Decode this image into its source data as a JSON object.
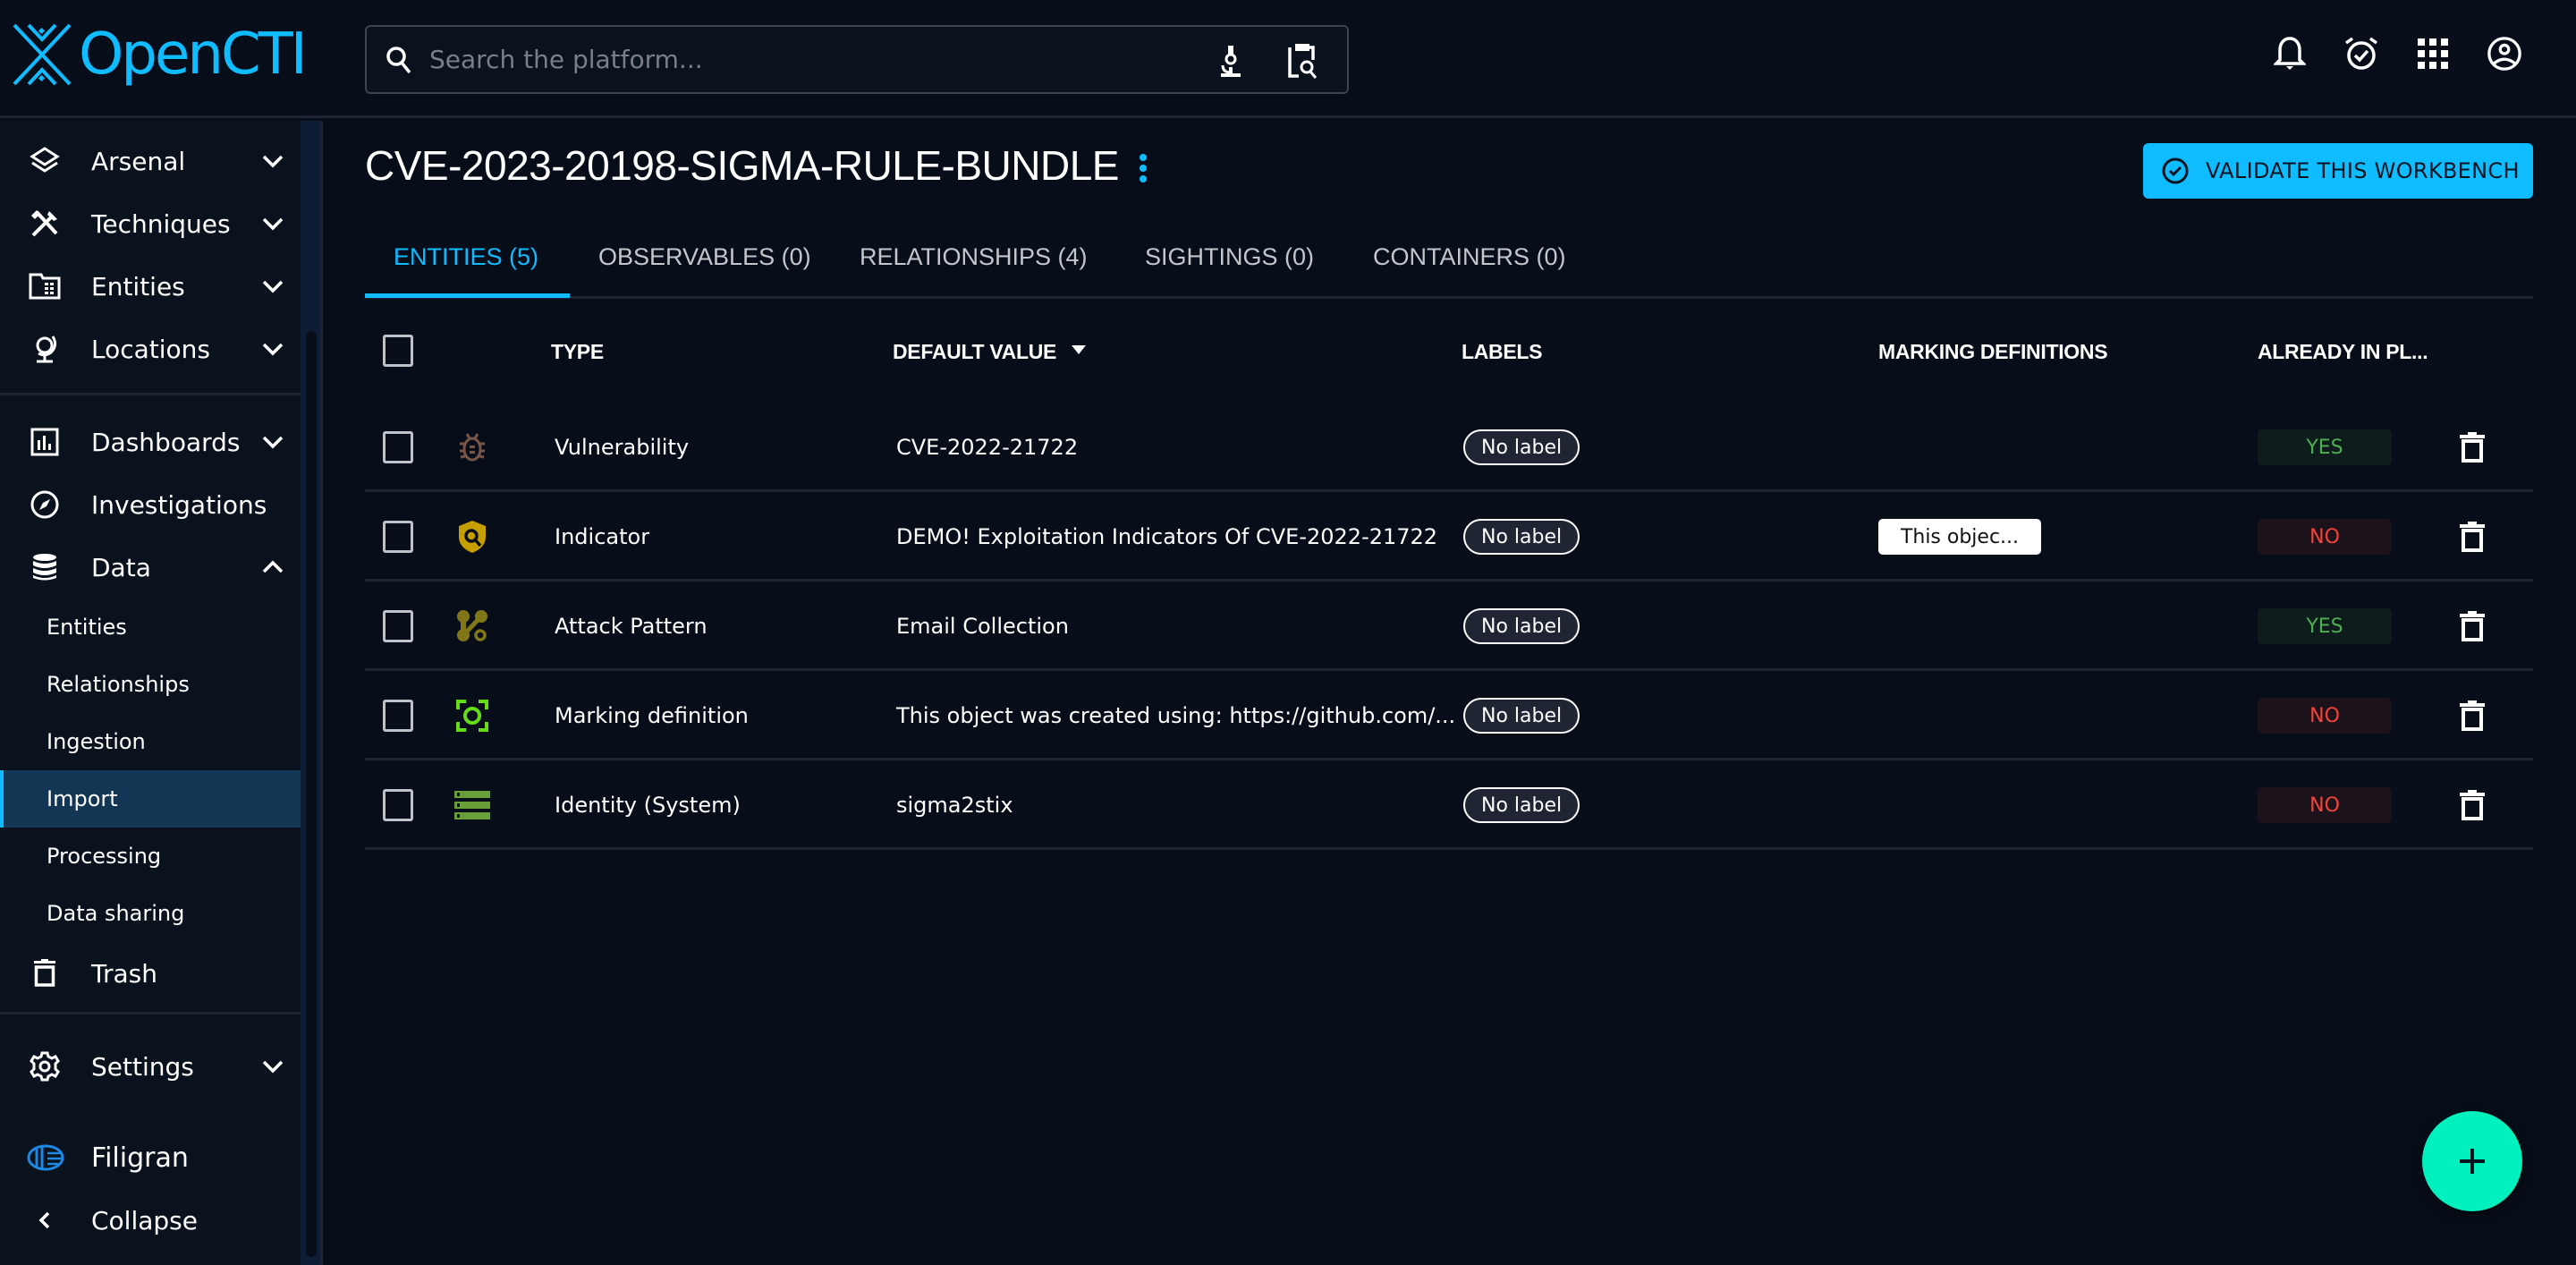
{
  "app": {
    "brand": "OpenCTI",
    "brand_color": "#0fbcff"
  },
  "search": {
    "placeholder": "Search the platform...",
    "value": "",
    "icons": [
      "search-icon",
      "microscope-icon",
      "clipboard-search-icon"
    ]
  },
  "top_icons": [
    "bell-icon",
    "alarm-check-icon",
    "apps-grid-icon",
    "account-circle-icon"
  ],
  "sidebar": {
    "items": [
      {
        "label": "Arsenal",
        "icon": "layers-icon",
        "expandable": true,
        "expanded": false
      },
      {
        "label": "Techniques",
        "icon": "tools-icon",
        "expandable": true,
        "expanded": false
      },
      {
        "label": "Entities",
        "icon": "folder-table-icon",
        "expandable": true,
        "expanded": false
      },
      {
        "label": "Locations",
        "icon": "globe-icon",
        "expandable": true,
        "expanded": false
      },
      {
        "label": "Dashboards",
        "icon": "chart-box-icon",
        "expandable": true,
        "expanded": false
      },
      {
        "label": "Investigations",
        "icon": "compass-icon",
        "expandable": false
      },
      {
        "label": "Data",
        "icon": "database-icon",
        "expandable": true,
        "expanded": true
      },
      {
        "label": "Trash",
        "icon": "trash-icon",
        "expandable": false
      },
      {
        "label": "Settings",
        "icon": "gear-icon",
        "expandable": true,
        "expanded": false
      }
    ],
    "data_subitems": [
      {
        "label": "Entities",
        "active": false
      },
      {
        "label": "Relationships",
        "active": false
      },
      {
        "label": "Ingestion",
        "active": false
      },
      {
        "label": "Import",
        "active": true
      },
      {
        "label": "Processing",
        "active": false
      },
      {
        "label": "Data sharing",
        "active": false
      }
    ],
    "footer_brand": "Filigran",
    "collapse_label": "Collapse"
  },
  "page": {
    "title": "CVE-2023-20198-SIGMA-RULE-BUNDLE",
    "validate_label": "VALIDATE THIS WORKBENCH"
  },
  "tabs": [
    {
      "label": "ENTITIES (5)",
      "active": true
    },
    {
      "label": "OBSERVABLES (0)",
      "active": false
    },
    {
      "label": "RELATIONSHIPS (4)",
      "active": false
    },
    {
      "label": "SIGHTINGS (0)",
      "active": false
    },
    {
      "label": "CONTAINERS (0)",
      "active": false
    }
  ],
  "table": {
    "headers": {
      "type": "TYPE",
      "default_value": "DEFAULT VALUE",
      "labels": "LABELS",
      "marking_definitions": "MARKING DEFINITIONS",
      "already_in_platform": "ALREADY IN PL..."
    },
    "sort": {
      "column": "default_value",
      "direction": "desc"
    },
    "rows": [
      {
        "type": "Vulnerability",
        "icon": "bug-icon",
        "icon_color": "#795548",
        "default_value": "CVE-2022-21722",
        "label": "No label",
        "marking": "",
        "already": "YES"
      },
      {
        "type": "Indicator",
        "icon": "shield-search-icon",
        "icon_color": "#c79e00",
        "default_value": "DEMO! Exploitation Indicators Of CVE-2022-21722",
        "label": "No label",
        "marking": "This objec...",
        "already": "NO"
      },
      {
        "type": "Attack Pattern",
        "icon": "attack-pattern-icon",
        "icon_color": "#827717",
        "default_value": "Email Collection",
        "label": "No label",
        "marking": "",
        "already": "YES"
      },
      {
        "type": "Marking definition",
        "icon": "marking-focus-icon",
        "icon_color": "#64dd17",
        "default_value": "This object was created using: https://github.com/...",
        "label": "No label",
        "marking": "",
        "already": "NO"
      },
      {
        "type": "Identity (System)",
        "icon": "server-icon",
        "icon_color": "#689f38",
        "default_value": "sigma2stix",
        "label": "No label",
        "marking": "",
        "already": "NO"
      }
    ]
  },
  "fab": {
    "icon": "plus-icon",
    "color": "#00f1bd"
  }
}
